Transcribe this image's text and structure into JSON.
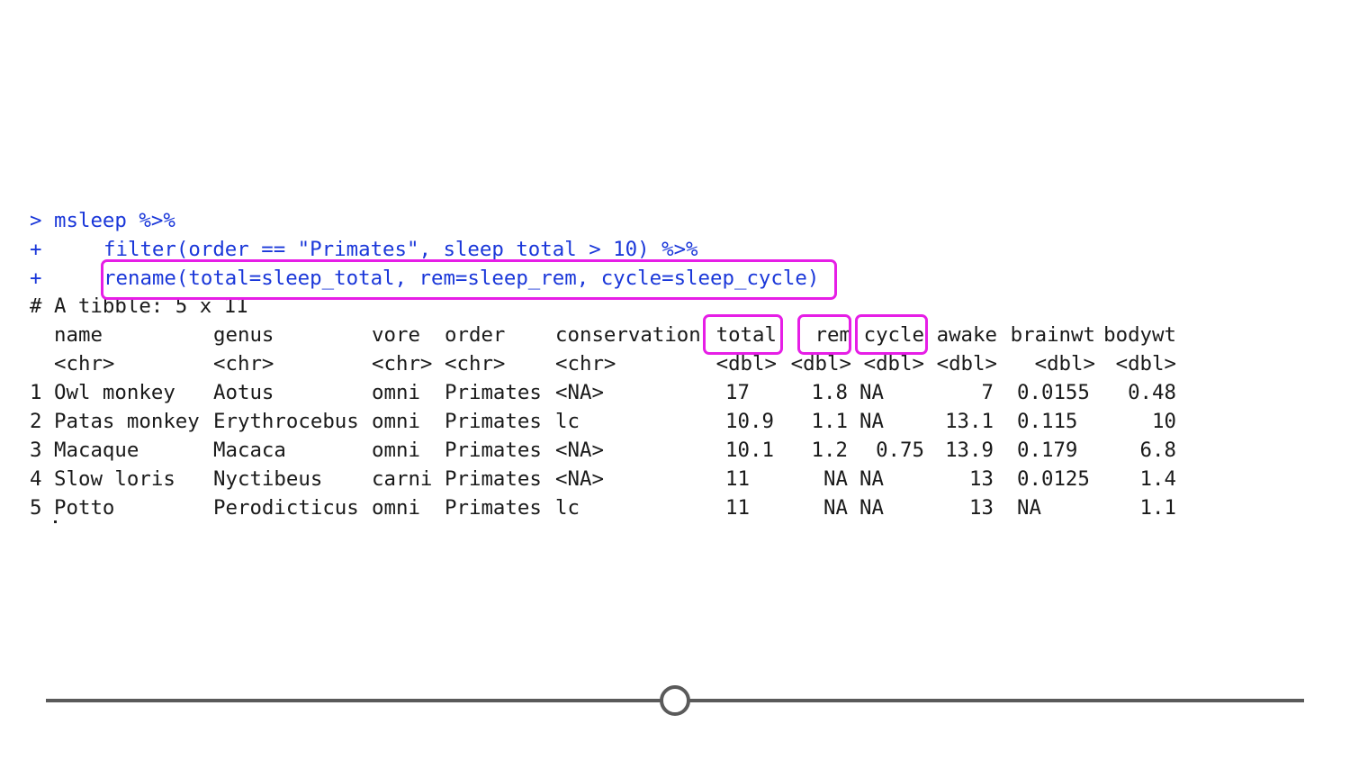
{
  "console": {
    "lines": [
      {
        "prompt": ">",
        "code": "msleep %>%"
      },
      {
        "prompt": "+",
        "code": "filter(order == \"Primates\", sleep_total > 10) %>%"
      },
      {
        "prompt": "+",
        "code": "rename(total=sleep_total, rem=sleep_rem, cycle=sleep_cycle)"
      }
    ],
    "tibble_header": "# A tibble: 5 x 11"
  },
  "table": {
    "columns": [
      "name",
      "genus",
      "vore",
      "order",
      "conservation",
      "total",
      "rem",
      "cycle",
      "awake",
      "brainwt",
      "bodywt"
    ],
    "types": [
      "<chr>",
      "<chr>",
      "<chr>",
      "<chr>",
      "<chr>",
      "<dbl>",
      "<dbl>",
      "<dbl>",
      "<dbl>",
      "<dbl>",
      "<dbl>"
    ],
    "rows": [
      {
        "index": "1",
        "cells": [
          "Owl monkey",
          "Aotus",
          "omni",
          "Primates",
          "<NA>",
          "17",
          "1.8",
          "NA",
          "7",
          "0.0155",
          "0.48"
        ]
      },
      {
        "index": "2",
        "cells": [
          "Patas monkey",
          "Erythrocebus",
          "omni",
          "Primates",
          "lc",
          "10.9",
          "1.1",
          "NA",
          "13.1",
          "0.115",
          "10"
        ]
      },
      {
        "index": "3",
        "cells": [
          "Macaque",
          "Macaca",
          "omni",
          "Primates",
          "<NA>",
          "10.1",
          "1.2",
          "0.75",
          "13.9",
          "0.179",
          "6.8"
        ]
      },
      {
        "index": "4",
        "cells": [
          "Slow loris",
          "Nyctibeus",
          "carni",
          "Primates",
          "<NA>",
          "11",
          "NA",
          "NA",
          "13",
          "0.0125",
          "1.4"
        ]
      },
      {
        "index": "5",
        "cells": [
          "Potto",
          "Perodicticus",
          "omni",
          "Primates",
          "lc",
          "11",
          "NA",
          "NA",
          "13",
          "NA",
          "1.1"
        ]
      }
    ]
  },
  "colors": {
    "command_text": "#1a37d9",
    "highlight": "#e61ee6",
    "output_text": "#1a1a1a",
    "timeline": "#5a5a5a"
  },
  "slider": {
    "position_fraction": 0.5
  }
}
